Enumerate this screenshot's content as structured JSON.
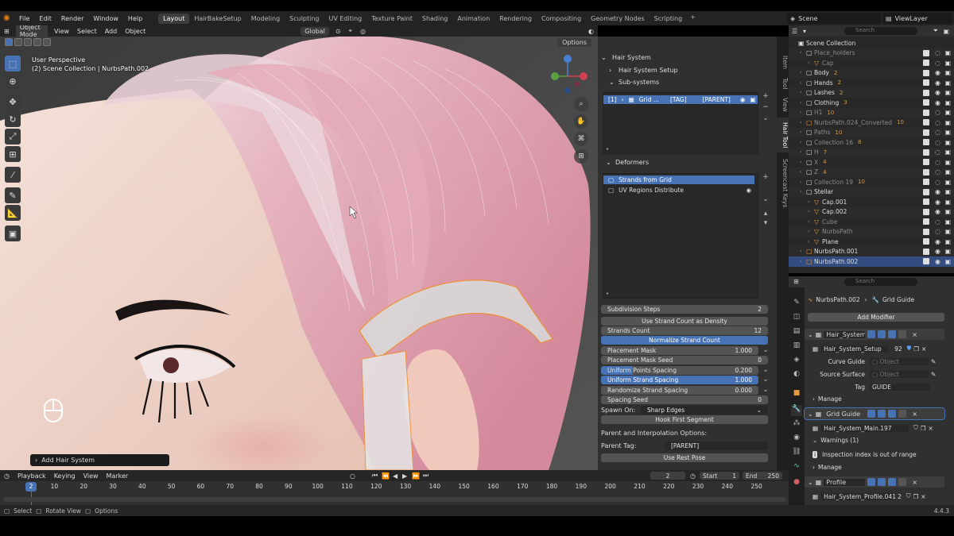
{
  "menu": {
    "items": [
      "File",
      "Edit",
      "Render",
      "Window",
      "Help"
    ],
    "workspaces": [
      "Layout",
      "HairBakeSetup",
      "Modeling",
      "Sculpting",
      "UV Editing",
      "Texture Paint",
      "Shading",
      "Animation",
      "Rendering",
      "Compositing",
      "Geometry Nodes",
      "Scripting"
    ],
    "active_workspace": "Layout",
    "scene": "Scene",
    "view_layer": "ViewLayer"
  },
  "viewport": {
    "mode": "Object Mode",
    "menus": [
      "View",
      "Select",
      "Add",
      "Object"
    ],
    "orientation": "Global",
    "options": "Options",
    "perspective": "User Perspective",
    "context": "(2) Scene Collection | NurbsPath.002",
    "last_op": "Add Hair System"
  },
  "npanel": {
    "tabs": [
      "Item",
      "Tool",
      "View",
      "Hair Tool",
      "Screencast Keys"
    ],
    "active_tab": "Hair Tool",
    "hair_system": "Hair System",
    "hair_system_setup": "Hair System Setup",
    "sub_systems": "Sub-systems",
    "list_item": {
      "index": "[1]",
      "name": "Grid ...",
      "tag": "[TAG]",
      "parent": "[PARENT]"
    },
    "deformers": "Deformers",
    "deformer_items": [
      "Strands from Grid",
      "UV Regions Distribute"
    ],
    "subdivision_steps": {
      "label": "Subdivision Steps",
      "value": "2"
    },
    "use_strand_count": "Use Strand Count as Density",
    "strands_count": {
      "label": "Strands Count",
      "value": "12"
    },
    "normalize": "Normalize Strand Count",
    "placement_mask": {
      "label": "Placement Mask",
      "value": "1.000"
    },
    "placement_mask_seed": {
      "label": "Placement Mask Seed",
      "value": "0"
    },
    "uniform_points": {
      "label": "Uniform Points Spacing",
      "value": "0.200"
    },
    "uniform_strand": {
      "label": "Uniform Strand Spacing",
      "value": "1.000"
    },
    "randomize": {
      "label": "Randomize Strand Spacing",
      "value": "0.000"
    },
    "spacing_seed": {
      "label": "Spacing Seed",
      "value": "0"
    },
    "spawn_on": {
      "label": "Spawn On:",
      "value": "Sharp Edges"
    },
    "hook_first": "Hook First Segment",
    "parent_interp": "Parent and Interpolation Options:",
    "parent_tag": {
      "label": "Parent Tag:",
      "value": "[PARENT]"
    },
    "use_rest_pose": "Use Rest Pose"
  },
  "outliner": {
    "search": "Search",
    "rows": [
      {
        "name": "Scene Collection",
        "indent": 0,
        "type": "scene"
      },
      {
        "name": "Place_holders",
        "indent": 1,
        "dim": true,
        "extra": ""
      },
      {
        "name": "Cap",
        "indent": 2,
        "dim": true,
        "extra": ""
      },
      {
        "name": "Body",
        "indent": 1,
        "extra": "2"
      },
      {
        "name": "Hands",
        "indent": 1,
        "extra": "2"
      },
      {
        "name": "Lashes",
        "indent": 1,
        "extra": "2"
      },
      {
        "name": "Clothing",
        "indent": 1,
        "extra": "3"
      },
      {
        "name": "H1",
        "indent": 1,
        "dim": true,
        "extra": "10"
      },
      {
        "name": "NurbsPath.024_Converted",
        "indent": 1,
        "dim": true,
        "extra": "10"
      },
      {
        "name": "Paths",
        "indent": 1,
        "dim": true,
        "extra": "10"
      },
      {
        "name": "Collection 16",
        "indent": 1,
        "dim": true,
        "extra": "8"
      },
      {
        "name": "H",
        "indent": 1,
        "dim": true,
        "extra": "7"
      },
      {
        "name": "X",
        "indent": 1,
        "dim": true,
        "extra": "4"
      },
      {
        "name": "Z",
        "indent": 1,
        "dim": true,
        "extra": "4"
      },
      {
        "name": "Collection 19",
        "indent": 1,
        "dim": true,
        "extra": "10"
      },
      {
        "name": "Stellar",
        "indent": 1,
        "extra": ""
      },
      {
        "name": "Cap.001",
        "indent": 2,
        "extra": ""
      },
      {
        "name": "Cap.002",
        "indent": 2,
        "extra": ""
      },
      {
        "name": "Cube",
        "indent": 2,
        "dim": true,
        "extra": ""
      },
      {
        "name": "NurbsPath",
        "indent": 2,
        "dim": true,
        "extra": ""
      },
      {
        "name": "Plane",
        "indent": 2,
        "extra": ""
      },
      {
        "name": "NurbsPath.001",
        "indent": 1,
        "extra": ""
      },
      {
        "name": "NurbsPath.002",
        "indent": 1,
        "selected": true,
        "extra": ""
      }
    ]
  },
  "properties": {
    "search": "Search",
    "breadcrumb_obj": "NurbsPath.002",
    "breadcrumb_mod": "Grid Guide",
    "add_modifier": "Add Modifier",
    "mod1_name": "Hair_System...",
    "mod1_group": "Hair_System_Setup",
    "mod1_users": "92",
    "curve_guide": "Curve Guide",
    "source_surface": "Source Surface",
    "object_placeholder": "Object",
    "tag_label": "Tag",
    "tag_value": "GUIDE",
    "manage": "Manage",
    "mod2_name": "Grid Guide",
    "mod2_group": "Hair_System_Main.197",
    "warnings": "Warnings (1)",
    "warning_text": "Inspection index is out of range",
    "mod3_name": "Profile",
    "mod3_group": "Hair_System_Profile.041",
    "mod3_users": "2"
  },
  "timeline": {
    "menus": [
      "Playback",
      "Keying",
      "View",
      "Marker"
    ],
    "current_frame": "2",
    "start_label": "Start",
    "start": "1",
    "end_label": "End",
    "end": "250",
    "ticks": [
      "2",
      "10",
      "20",
      "30",
      "40",
      "50",
      "60",
      "70",
      "80",
      "90",
      "100",
      "110",
      "120",
      "130",
      "140",
      "150",
      "160",
      "170",
      "180",
      "190",
      "200",
      "210",
      "220",
      "230",
      "240",
      "250"
    ]
  },
  "status": {
    "items": [
      "Select",
      "Rotate View",
      "Options"
    ],
    "version": "4.4.3"
  },
  "colors": {
    "accent": "#4772b3",
    "orange": "#e87d0d",
    "bg": "#303030"
  }
}
